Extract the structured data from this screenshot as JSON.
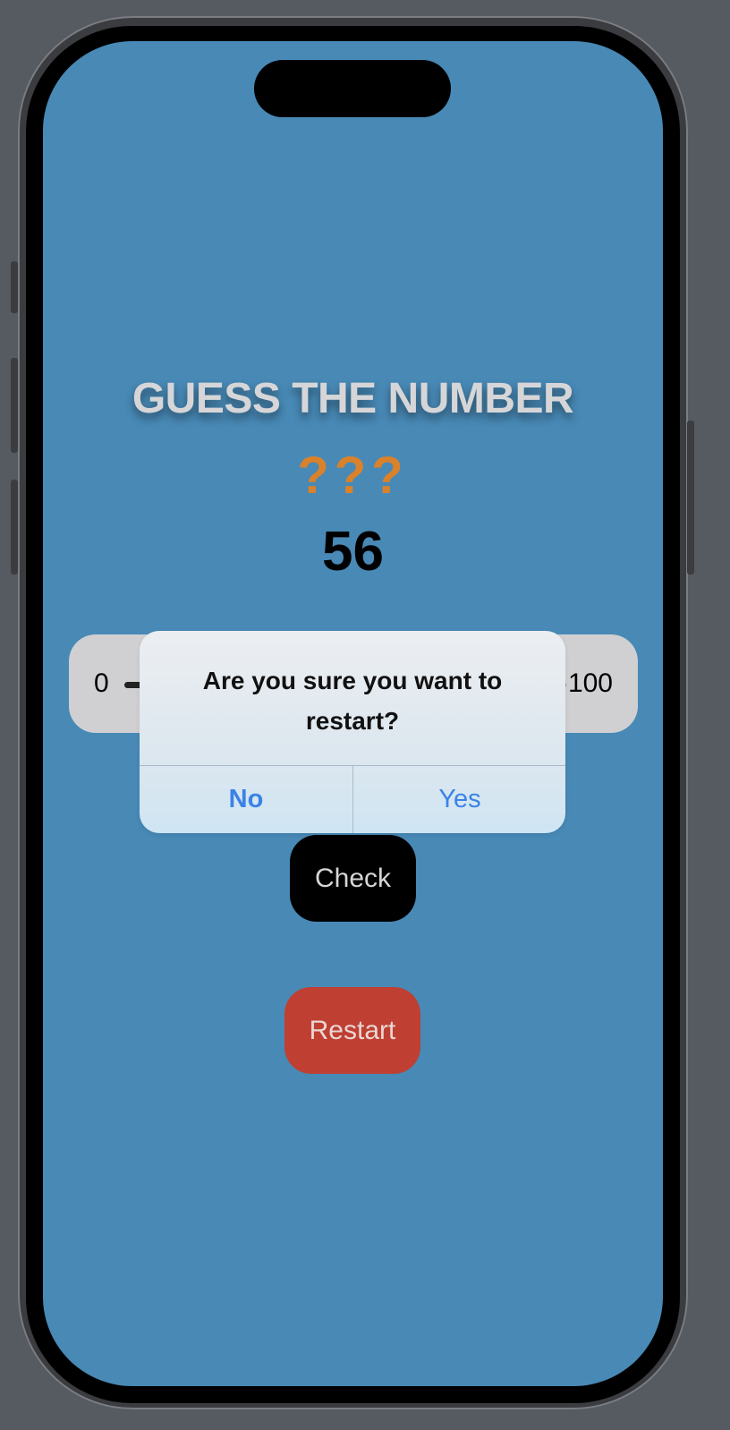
{
  "app": {
    "title": "GUESS THE NUMBER",
    "secret_placeholder": "???",
    "current_guess": "56"
  },
  "slider": {
    "min_label": "0",
    "max_label": "100",
    "value": 56
  },
  "buttons": {
    "check_label": "Check",
    "restart_label": "Restart"
  },
  "alert": {
    "message": "Are you sure you want to restart?",
    "no_label": "No",
    "yes_label": "Yes"
  },
  "colors": {
    "background": "#4889b6",
    "title": "#d6d6d8",
    "secret": "#d9822b",
    "check_button": "#000000",
    "restart_button": "#bf3f32",
    "alert_action": "#3a82e6"
  }
}
